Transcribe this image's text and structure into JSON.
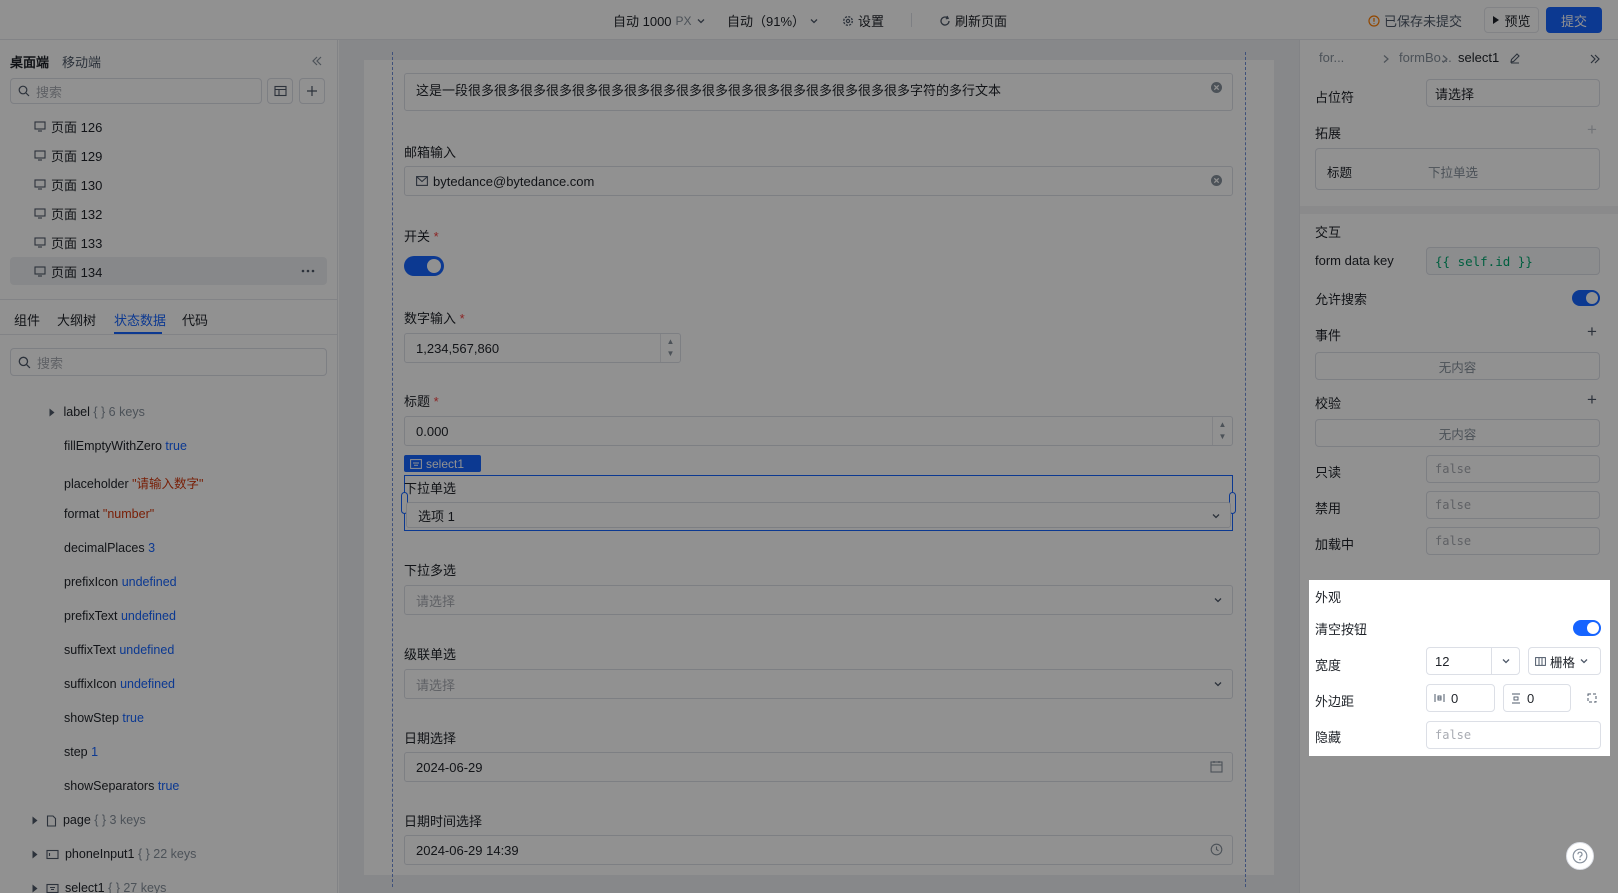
{
  "topbar": {
    "width_label": "自动 1000",
    "width_unit": "PX",
    "zoom_label": "自动（91%）",
    "settings_label": "设置",
    "refresh_label": "刷新页面",
    "save_status": "已保存未提交",
    "preview_label": "预览",
    "submit_label": "提交"
  },
  "left_panel": {
    "device_tabs": [
      "桌面端",
      "移动端"
    ],
    "search_placeholder": "搜索",
    "pages": [
      "页面 126",
      "页面 129",
      "页面 130",
      "页面 132",
      "页面 133",
      "页面 134"
    ],
    "active_page": "页面 134",
    "tabs": [
      "组件",
      "大纲树",
      "状态数据",
      "代码"
    ],
    "active_tab": "状态数据",
    "state_search_placeholder": "搜索",
    "state_rows": [
      {
        "key": "label",
        "meta": "{ } 6 keys"
      },
      {
        "key": "fillEmptyWithZero",
        "value": "true"
      },
      {
        "key": "placeholder",
        "value": "\"请输入数字\""
      },
      {
        "key": "format",
        "value": "\"number\""
      },
      {
        "key": "decimalPlaces",
        "value": "3"
      },
      {
        "key": "prefixIcon",
        "value": "undefined"
      },
      {
        "key": "prefixText",
        "value": "undefined"
      },
      {
        "key": "suffixText",
        "value": "undefined"
      },
      {
        "key": "suffixIcon",
        "value": "undefined"
      },
      {
        "key": "showStep",
        "value": "true"
      },
      {
        "key": "step",
        "value": "1"
      },
      {
        "key": "showSeparators",
        "value": "true"
      },
      {
        "key": "page",
        "meta": "{ } 3 keys"
      },
      {
        "key": "phoneInput1",
        "meta": "{ } 22 keys"
      },
      {
        "key": "select1",
        "meta": "{ } 27 keys"
      }
    ]
  },
  "form": {
    "textarea_value": "这是一段很多很多很多很多很多很多很多很多很多很多很多很多很多很多很多很多很多字符的多行文本",
    "email_label": "邮箱输入",
    "email_value": "bytedance@bytedance.com",
    "switch_label": "开关",
    "number_label": "数字输入",
    "number_value": "1,234,567,860",
    "title_label": "标题",
    "title_value": "0.000",
    "selected_component": "select1",
    "single_select_label": "下拉单选",
    "single_select_value": "选项 1",
    "multi_select_label": "下拉多选",
    "multi_select_placeholder": "请选择",
    "cascader_label": "级联单选",
    "cascader_placeholder": "请选择",
    "date_label": "日期选择",
    "date_value": "2024-06-29",
    "datetime_label": "日期时间选择",
    "datetime_value": "2024-06-29 14:39",
    "required_mark": "*"
  },
  "right_panel": {
    "breadcrumb": [
      "for...",
      "formBo...",
      "select1"
    ],
    "placeholder_label": "占位符",
    "placeholder_value": "请选择",
    "extend_label": "拓展",
    "extend_title_label": "标题",
    "extend_title_value": "下拉单选",
    "interaction_label": "交互",
    "form_data_key_label": "form data key",
    "form_data_key_value": "{{ self.id }}",
    "allow_search_label": "允许搜索",
    "events_label": "事件",
    "events_empty": "无内容",
    "validation_label": "校验",
    "validation_empty": "无内容",
    "readonly_label": "只读",
    "readonly_value": "false",
    "disabled_label": "禁用",
    "disabled_value": "false",
    "loading_label": "加载中",
    "loading_value": "false",
    "appearance_label": "外观",
    "clear_button_label": "清空按钮",
    "width_label": "宽度",
    "width_value": "12",
    "width_mode": "栅格",
    "margin_label": "外边距",
    "margin_x": "0",
    "margin_y": "0",
    "hidden_label": "隐藏",
    "hidden_value": "false"
  },
  "colors": {
    "accent": "#1664ff",
    "canvas_bg": "#eef0f3",
    "code_green": "#00a870",
    "string_red": "#d4380d"
  }
}
